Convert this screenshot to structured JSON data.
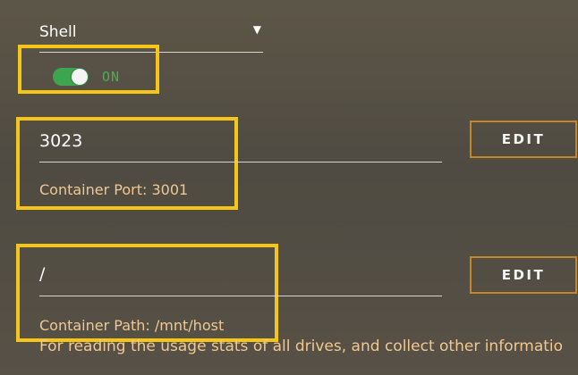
{
  "type_select": {
    "value": "Shell"
  },
  "toggle": {
    "state": true,
    "label": "ON"
  },
  "port": {
    "value": "3023",
    "helper": "Container Port: 3001",
    "edit_label": "EDIT"
  },
  "path": {
    "value": "/",
    "helper": "Container Path: /mnt/host",
    "edit_label": "EDIT",
    "description": "For reading the usage stats of all drives, and collect other informatio"
  },
  "colors": {
    "highlight": "#f5c518",
    "toggle_on": "#3ea54f",
    "helper_text": "#f0c890",
    "button_border": "#c7852b"
  }
}
